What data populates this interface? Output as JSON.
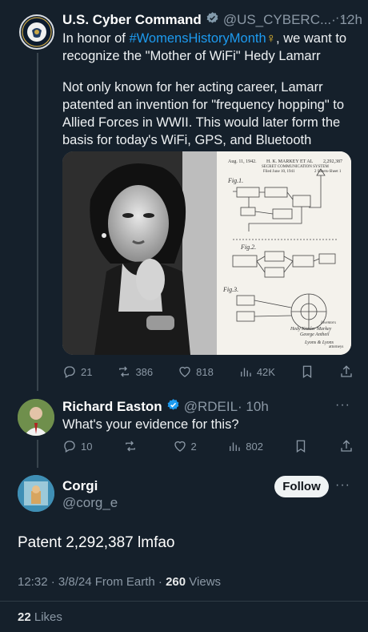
{
  "tweet1": {
    "name": "U.S. Cyber Command",
    "handle": "@US_CYBERC...",
    "time": "· 12h",
    "text_prefix": "In honor of",
    "hashtag": "#WomensHistoryMonth",
    "emoji": "♀",
    "text_suffix": ", we want to",
    "line2": "recognize the \"Mother of WiFi\" Hedy Lamarr",
    "paragraph": "Not only known for her acting career, Lamarr patented an invention for \"frequency hopping\" to Allied Forces in WWII. This would later form the basis for today's WiFi, GPS, and Bluetooth",
    "patent": {
      "date": "Aug. 11, 1942.",
      "inventors": "H. K. MARKEY ET AL",
      "number": "2,292,387",
      "subtitle": "SECRET COMMUNICATION SYSTEM",
      "filed": "Filed June 10, 1941",
      "sheets": "2 Sheets-Sheet 1",
      "fig1": "Fig.1.",
      "fig2": "Fig.2.",
      "fig3": "Fig.3.",
      "sig_label": "Inventors",
      "sig1": "Hedy Kiesler Markey",
      "sig2": "George Antheil",
      "sig3": "Lyons & Lyons",
      "sig4": "attorneys"
    },
    "replies": "21",
    "retweets": "386",
    "likes": "818",
    "views": "42K",
    "more": "···"
  },
  "tweet2": {
    "name": "Richard Easton",
    "handle": "@RDEIL",
    "time": "· 10h",
    "text": "What's your evidence for this?",
    "replies": "10",
    "retweets": "",
    "likes": "2",
    "views": "802",
    "more": "···"
  },
  "tweet3": {
    "name": "Corgi",
    "handle": "@corg_e",
    "follow_label": "Follow",
    "text": "Patent 2,292,387 lmfao",
    "time": "12:32 · 3/8/24 From Earth ·",
    "views_count": "260",
    "views_label": "Views",
    "likes_count": "22",
    "likes_label": "Likes",
    "more": "···"
  },
  "colors": {
    "background": "#15202b",
    "accent": "#1d9bf0",
    "muted": "#8b98a5"
  }
}
